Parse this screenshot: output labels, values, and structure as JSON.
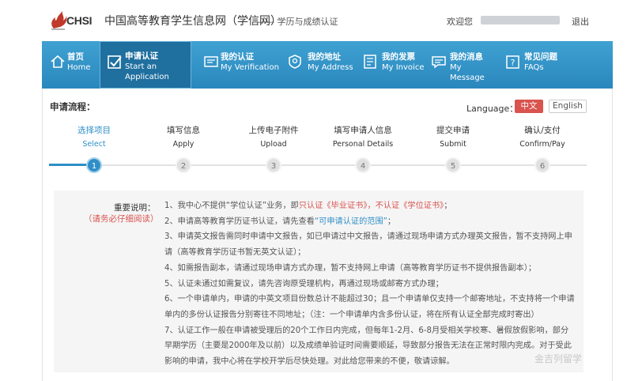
{
  "header": {
    "logo_text": "CHSI",
    "site_title": "中国高等教育学生信息网（学信网）",
    "site_subtitle": "—— 学历与成绩认证",
    "welcome": "欢迎您",
    "logout": "退出"
  },
  "nav": [
    {
      "cn": "首页",
      "en": "Home",
      "icon": "home-icon"
    },
    {
      "cn": "申请认证",
      "en": "Start an Application",
      "en2": "Application",
      "en1": "Start an",
      "icon": "check-box-icon",
      "active": true
    },
    {
      "cn": "我的认证",
      "en": "My Verification",
      "icon": "certificate-icon"
    },
    {
      "cn": "我的地址",
      "en": "My Address",
      "icon": "location-icon"
    },
    {
      "cn": "我的发票",
      "en": "My Invoice",
      "icon": "invoice-icon"
    },
    {
      "cn": "我的消息",
      "en1": "My",
      "en2": "Message",
      "icon": "message-icon"
    },
    {
      "cn": "常见问题",
      "en": "FAQs",
      "icon": "faq-icon"
    }
  ],
  "flow": {
    "label": "申请流程：",
    "language_label": "Language：",
    "lang_cn": "中文",
    "lang_en": "English",
    "steps": [
      {
        "cn": "选择项目",
        "en": "Select",
        "num": "1",
        "active": true
      },
      {
        "cn": "填写信息",
        "en": "Apply",
        "num": "2"
      },
      {
        "cn": "上传电子附件",
        "en": "Upload",
        "num": "3"
      },
      {
        "cn": "填写申请人信息",
        "en": "Personal Details",
        "num": "4"
      },
      {
        "cn": "提交申请",
        "en": "Submit",
        "num": "5"
      },
      {
        "cn": "确认/支付",
        "en": "Confirm/Pay",
        "num": "6"
      }
    ],
    "current_step": 1
  },
  "notice": {
    "title": "重要说明：",
    "subtitle": "（请务必仔细阅读）",
    "l1a": "1、我中心不提供“学位认证”业务，即",
    "l1b": "只认证《毕业证书》，不认证《学位证书》",
    "l1c": "；",
    "l2a": "2、申请高等教育学历证书认证，请先查看",
    "l2b": "“可申请认证的范围”",
    "l2c": "；",
    "l3": "3、申请英文报告需同时申请中文报告，如已申请过中文报告，请通过现场申请方式办理英文报告，暂不支持网上申",
    "l4": "请（高等教育学历证书暂无英文认证）；",
    "l5": "4、如需报告副本，请通过现场申请方式办理，暂不支持网上申请（高等教育学历证书不提供报告副本）；",
    "l6": "5、认证未通过如需复议，请先咨询原受理机构，再通过现场或邮寄方式办理；",
    "l7": "6、一个申请单内，申请的中英文项目份数总计不能超过30；且一个申请单仅支持一个邮寄地址，不支持将一个申请",
    "l8": "单内的多份认证报告分别寄往不同地址；（注：一个申请单内含多份认证，将在所有认证全部完成时寄出）",
    "l9": "7、认证工作一般在申请被受理后的20个工作日内完成，但每年1-2月、6-8月受相关学校寒、暑假放假影响，部分",
    "l10": "早期学历（主要是2000年及以前）以及成绩单验证时间需要顺延，导致部分报告无法在正常时限内完成。对于受此",
    "l11": "影响的申请，我中心将在学校开学后尽快处理。对此给您带来的不便，敬请谅解。"
  },
  "watermark": "金吉列留学",
  "colors": {
    "nav_bg": "#2f93c9",
    "accent": "#2f8fc7",
    "red": "#d9534f"
  }
}
